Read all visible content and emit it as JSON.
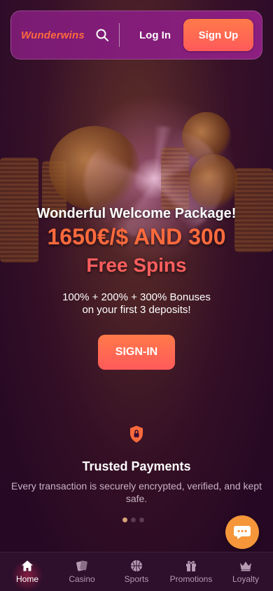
{
  "header": {
    "logo": "Wunderwins",
    "login_label": "Log In",
    "signup_label": "Sign Up"
  },
  "hero": {
    "title": "Wonderful Welcome Package!",
    "amount": "1650€/$ AND 300",
    "spins": "Free Spins",
    "subtitle_line1": "100% + 200% + 300% Bonuses",
    "subtitle_line2": "on your first 3 deposits!",
    "cta_label": "SIGN-IN"
  },
  "trusted": {
    "title": "Trusted Payments",
    "description": "Every transaction is securely encrypted, verified, and kept safe."
  },
  "carousel": {
    "active_index": 0,
    "count": 3
  },
  "bottom_nav": {
    "items": [
      {
        "label": "Home",
        "icon": "home-icon",
        "active": true
      },
      {
        "label": "Casino",
        "icon": "cards-icon",
        "active": false
      },
      {
        "label": "Sports",
        "icon": "basketball-icon",
        "active": false
      },
      {
        "label": "Promotions",
        "icon": "gift-icon",
        "active": false
      },
      {
        "label": "Loyalty",
        "icon": "crown-icon",
        "active": false
      }
    ]
  },
  "colors": {
    "accent": "#ff6a3d",
    "header_bg": "#7a1b72",
    "page_bg": "#2a0b27",
    "chat_button": "#f5963a"
  }
}
